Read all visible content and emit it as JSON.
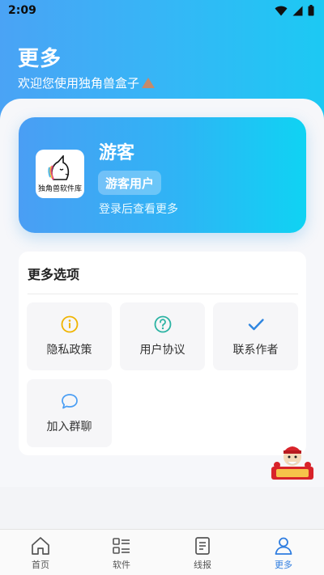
{
  "status_bar": {
    "time": "2:09",
    "wifi_icon": "wifi-icon",
    "signal_icon": "signal-icon",
    "battery_icon": "battery-icon"
  },
  "header": {
    "title": "更多",
    "subtitle": "欢迎您使用独角兽盒子",
    "subtitle_icon": "triangle-icon"
  },
  "profile": {
    "avatar_icon": "unicorn-logo",
    "avatar_caption": "独角兽软件库",
    "name": "游客",
    "badge": "游客用户",
    "hint": "登录后查看更多"
  },
  "options": {
    "title": "更多选项",
    "items": [
      {
        "label": "隐私政策",
        "icon": "info-icon",
        "color": "#f0b400"
      },
      {
        "label": "用户协议",
        "icon": "help-icon",
        "color": "#2bb3a3"
      },
      {
        "label": "联系作者",
        "icon": "check-icon",
        "color": "#2f86e0"
      },
      {
        "label": "加入群聊",
        "icon": "chat-bubble-icon",
        "color": "#4a9ef4"
      }
    ]
  },
  "tab_bar": {
    "items": [
      {
        "label": "首页",
        "icon": "home-icon",
        "active": false
      },
      {
        "label": "软件",
        "icon": "apps-list-icon",
        "active": false
      },
      {
        "label": "线报",
        "icon": "document-icon",
        "active": false
      },
      {
        "label": "更多",
        "icon": "user-icon",
        "active": true
      }
    ],
    "active_color": "#2e7de0",
    "inactive_color": "#555555"
  },
  "colors": {
    "accent": "#2e7de0",
    "gradient_start": "#4aa3f5",
    "gradient_end": "#1cc9f3"
  }
}
